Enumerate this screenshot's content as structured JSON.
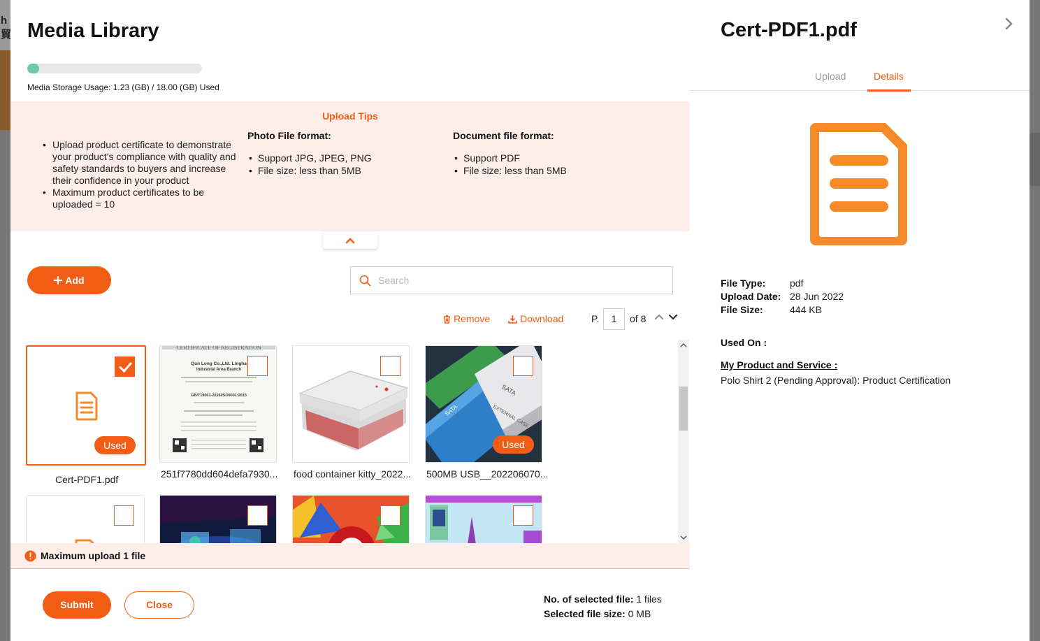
{
  "background": {
    "left_text": "h\n貿"
  },
  "media_library": {
    "title": "Media Library",
    "storage_text": "Media Storage Usage: 1.23 (GB) / 18.00 (GB) Used",
    "storage_used_fraction": 0.068,
    "tips": {
      "title": "Upload Tips",
      "general": [
        "Upload product certificate to demonstrate your product's compliance with quality and safety standards to buyers and increase their confidence in your product",
        "Maximum product certificates to be uploaded = 10"
      ],
      "photo_heading": "Photo File format:",
      "photo_items": [
        "Support JPG, JPEG, PNG",
        "File size: less than 5MB"
      ],
      "doc_heading": "Document file format:",
      "doc_items": [
        "Support PDF",
        "File size: less than 5MB"
      ]
    },
    "add_label": "Add",
    "search_placeholder": "Search",
    "remove_label": "Remove",
    "download_label": "Download",
    "page_prefix": "P.",
    "page_current": "1",
    "page_total_text": "of 8",
    "files": [
      {
        "name": "Cert-PDF1.pdf",
        "used": "Used"
      },
      {
        "name": "251f7780dd604defa7930..."
      },
      {
        "name": "food container kitty_2022..."
      },
      {
        "name": "500MB USB__202206070...",
        "used": "Used"
      }
    ],
    "warning": "Maximum upload 1 file",
    "submit_label": "Submit",
    "close_label": "Close",
    "selected_count_label": "No. of selected file:",
    "selected_count_value": "1 files",
    "selected_size_label": "Selected file size:",
    "selected_size_value": "0 MB"
  },
  "details_panel": {
    "title": "Cert-PDF1.pdf",
    "tab_upload": "Upload",
    "tab_details": "Details",
    "file_type_label": "File Type:",
    "file_type_value": "pdf",
    "upload_date_label": "Upload Date:",
    "upload_date_value": "28 Jun 2022",
    "file_size_label": "File Size:",
    "file_size_value": "444 KB",
    "used_on_label": "Used On :",
    "section_label": "My Product and Service :",
    "section_value": "Polo Shirt 2 (Pending Approval): Product Certification"
  },
  "colors": {
    "accent": "#f25d16",
    "storage_fill": "#6cc9ae",
    "tips_bg": "#fdeeea"
  }
}
